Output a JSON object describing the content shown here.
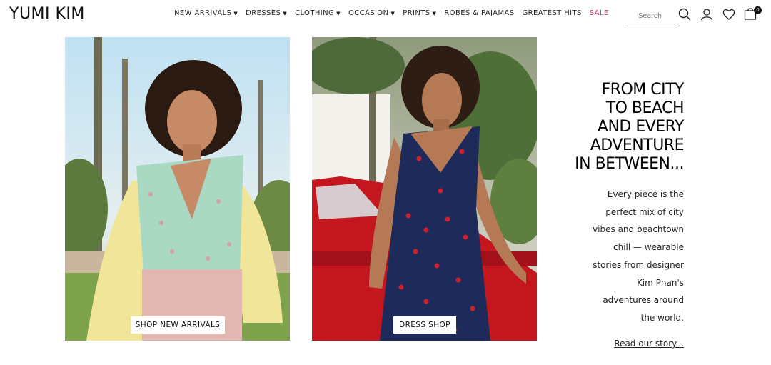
{
  "brand": {
    "logo_text": "YUMI KIM"
  },
  "nav": {
    "items": [
      {
        "label": "NEW ARRIVALS",
        "has_caret": true
      },
      {
        "label": "DRESSES",
        "has_caret": true
      },
      {
        "label": "CLOTHING",
        "has_caret": true
      },
      {
        "label": "OCCASION",
        "has_caret": true
      },
      {
        "label": "PRINTS",
        "has_caret": true
      },
      {
        "label": "ROBES & PAJAMAS",
        "has_caret": false
      },
      {
        "label": "GREATEST HITS",
        "has_caret": false
      },
      {
        "label": "SALE",
        "has_caret": false
      }
    ],
    "caret_glyph": "▼",
    "sale_color": "#d6336c"
  },
  "search": {
    "placeholder": "Search"
  },
  "header_icons": [
    "search-icon",
    "account-icon",
    "heart-icon",
    "bag-icon"
  ],
  "cart": {
    "count": "0"
  },
  "hero": {
    "left_cta": "SHOP NEW ARRIVALS",
    "right_cta": "DRESS SHOP"
  },
  "story": {
    "headline_lines": [
      "FROM CITY",
      "TO BEACH",
      "AND EVERY",
      "ADVENTURE",
      "IN BETWEEN..."
    ],
    "body_lines": [
      "Every piece is the",
      "perfect mix of city",
      "vibes and beachtown",
      "chill — wearable",
      "stories from designer",
      "Kim Phan's",
      "adventures around",
      "the world."
    ],
    "link": "Read our story..."
  }
}
